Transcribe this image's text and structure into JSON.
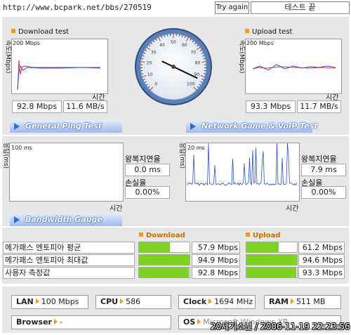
{
  "top": {
    "url": "http://www.bcpark.net/bbs/270519",
    "try_again": "Try again",
    "test_end": "테스트 끝"
  },
  "download": {
    "title": "Download test",
    "y_axis": "속도(Mbps)",
    "scale": "200 Mbps",
    "x_axis": "시간",
    "speed_mbps": "92.8 Mbps",
    "speed_mbs": "11.6 MB/s"
  },
  "upload": {
    "title": "Upload test",
    "y_axis": "속도(Mbps)",
    "scale": "200 Mbps",
    "x_axis": "시간",
    "speed_mbps": "93.3 Mbps",
    "speed_mbs": "11.7 MB/s"
  },
  "gauge": {
    "ticks": [
      "0",
      "10",
      "20",
      "30",
      "40",
      "50",
      "60",
      "70",
      "80",
      "90",
      "100"
    ],
    "value": 92.8
  },
  "ping": {
    "tab": "General Ping Test",
    "y_axis": "응답(ms)",
    "scale": "100 ms",
    "x_axis": "시간",
    "rtt_label": "왕복지연율",
    "rtt_value": "0.0 ms",
    "loss_label": "손실율",
    "loss_value": "0.00%"
  },
  "game": {
    "tab": "Network Game & VoIP Test",
    "y_axis": "응답(ms)",
    "scale": "20 ms",
    "x_axis": "시간",
    "rtt_label": "왕복지연율",
    "rtt_value": "7.9 ms",
    "loss_label": "손실율",
    "loss_value": "0.00%"
  },
  "bandwidth": {
    "tab": "Bandwidth Gauge",
    "download_header": "Download",
    "upload_header": "Upload",
    "rows": [
      {
        "label": "메가패스 엔토피아 평균",
        "down": "57.9 Mbps",
        "down_frac": 0.61,
        "up": "61.2 Mbps",
        "up_frac": 0.64
      },
      {
        "label": "메가패스 엔토피아 최대값",
        "down": "94.9 Mbps",
        "down_frac": 1.0,
        "up": "94.6 Mbps",
        "up_frac": 1.0
      },
      {
        "label": "사용자 측정값",
        "down": "92.8 Mbps",
        "down_frac": 0.98,
        "up": "93.3 Mbps",
        "up_frac": 0.99
      }
    ]
  },
  "sysinfo": {
    "lan_label": "LAN",
    "lan_value": "100 Mbps",
    "cpu_label": "CPU",
    "cpu_value": "586",
    "clock_label": "Clock",
    "clock_value": "1694 MHz",
    "ram_label": "RAM",
    "ram_value": "511 MB",
    "browser_label": "Browser",
    "browser_value": "-",
    "os_label": "OS",
    "os_value": "Microsoft Windows XP",
    "watermark": "20세기소년 / 2006-11-19 22:23:56"
  },
  "colors": {
    "accent": "#f19a1c",
    "bar": "#7ed321",
    "tab": "#9fbaec",
    "line_blue": "#2b52c8",
    "line_red": "#d43a2a"
  }
}
